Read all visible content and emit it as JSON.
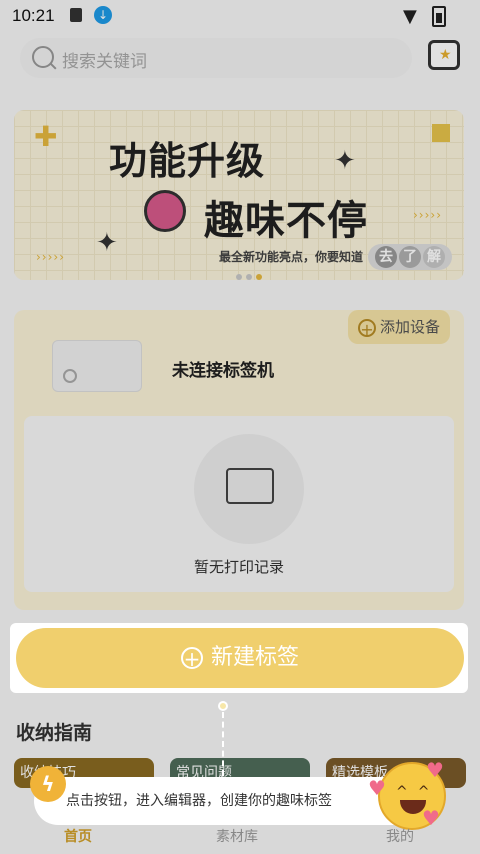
{
  "status_bar": {
    "time": "10:21"
  },
  "search": {
    "placeholder": "搜索关键词"
  },
  "banner": {
    "line1": "功能升级",
    "line2": "趣味不停",
    "subtitle": "最全新功能亮点，你要知道",
    "cta_chars": [
      "去",
      "了",
      "解"
    ]
  },
  "device": {
    "add_button": "添加设备",
    "status": "未连接标签机",
    "empty_records": "暂无打印记录"
  },
  "primary_action": {
    "label": "新建标签"
  },
  "guide": {
    "section_title": "收纳指南",
    "cards": [
      "收纳技巧",
      "常见问题",
      "精选模板"
    ]
  },
  "tooltip": {
    "text": "点击按钮，进入编辑器，创建你的趣味标签"
  },
  "tabbar": {
    "items": [
      "首页",
      "素材库",
      "我的"
    ]
  },
  "colors": {
    "accent": "#f0cf6d",
    "banner_bg": "#fbf4dc",
    "tooltip_bg": "#ffffff"
  }
}
